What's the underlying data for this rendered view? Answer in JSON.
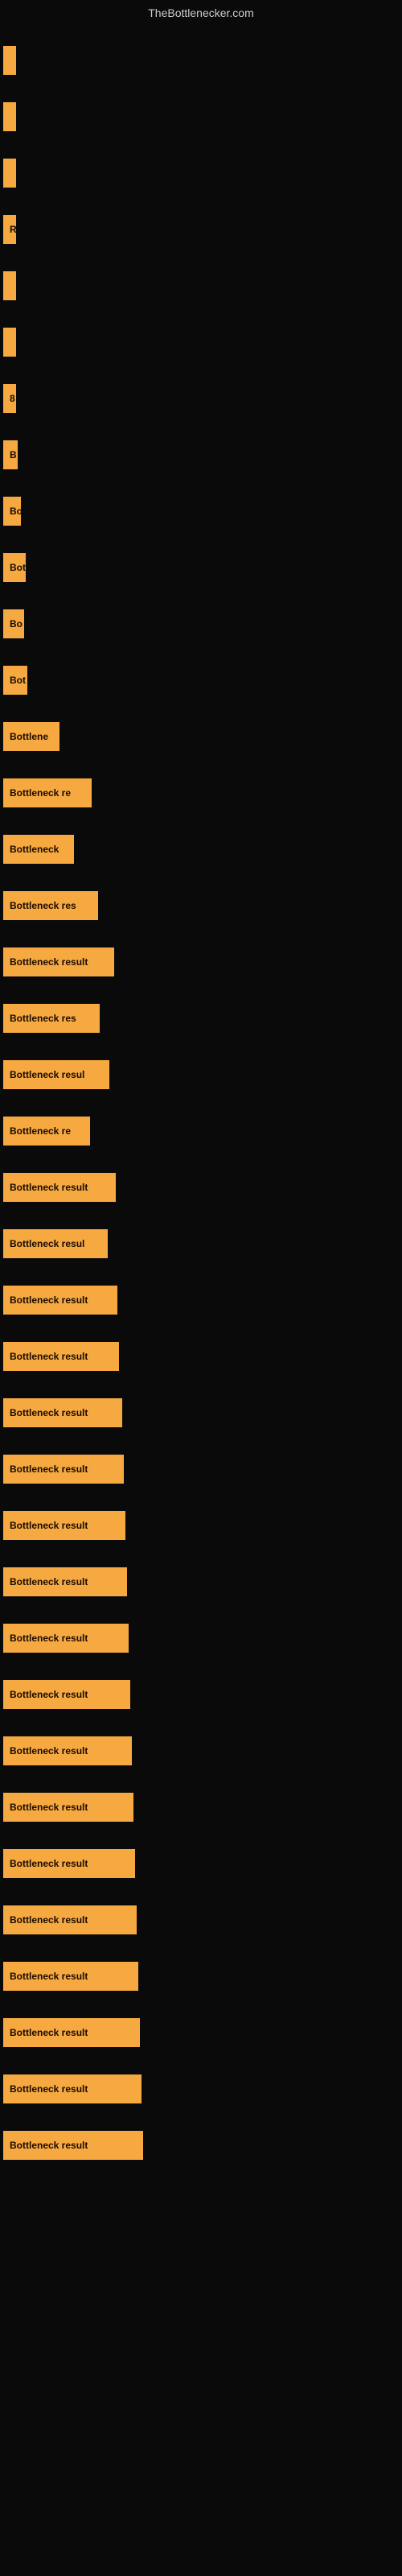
{
  "site": {
    "title": "TheBottlenecker.com"
  },
  "bars": [
    {
      "label": "",
      "width": 8
    },
    {
      "label": "",
      "width": 10
    },
    {
      "label": "",
      "width": 11
    },
    {
      "label": "R",
      "width": 14
    },
    {
      "label": "",
      "width": 10
    },
    {
      "label": "",
      "width": 11
    },
    {
      "label": "8",
      "width": 16
    },
    {
      "label": "B",
      "width": 18
    },
    {
      "label": "Bo",
      "width": 22
    },
    {
      "label": "Bot",
      "width": 28
    },
    {
      "label": "Bo",
      "width": 26
    },
    {
      "label": "Bot",
      "width": 30
    },
    {
      "label": "Bottlene",
      "width": 70
    },
    {
      "label": "Bottleneck re",
      "width": 110
    },
    {
      "label": "Bottleneck",
      "width": 88
    },
    {
      "label": "Bottleneck res",
      "width": 118
    },
    {
      "label": "Bottleneck result",
      "width": 138
    },
    {
      "label": "Bottleneck res",
      "width": 120
    },
    {
      "label": "Bottleneck resul",
      "width": 132
    },
    {
      "label": "Bottleneck re",
      "width": 108
    },
    {
      "label": "Bottleneck result",
      "width": 140
    },
    {
      "label": "Bottleneck resul",
      "width": 130
    },
    {
      "label": "Bottleneck result",
      "width": 142
    },
    {
      "label": "Bottleneck result",
      "width": 144
    },
    {
      "label": "Bottleneck result",
      "width": 148
    },
    {
      "label": "Bottleneck result",
      "width": 150
    },
    {
      "label": "Bottleneck result",
      "width": 152
    },
    {
      "label": "Bottleneck result",
      "width": 154
    },
    {
      "label": "Bottleneck result",
      "width": 156
    },
    {
      "label": "Bottleneck result",
      "width": 158
    },
    {
      "label": "Bottleneck result",
      "width": 160
    },
    {
      "label": "Bottleneck result",
      "width": 162
    },
    {
      "label": "Bottleneck result",
      "width": 164
    },
    {
      "label": "Bottleneck result",
      "width": 166
    },
    {
      "label": "Bottleneck result",
      "width": 168
    },
    {
      "label": "Bottleneck result",
      "width": 170
    },
    {
      "label": "Bottleneck result",
      "width": 172
    },
    {
      "label": "Bottleneck result",
      "width": 174
    }
  ]
}
